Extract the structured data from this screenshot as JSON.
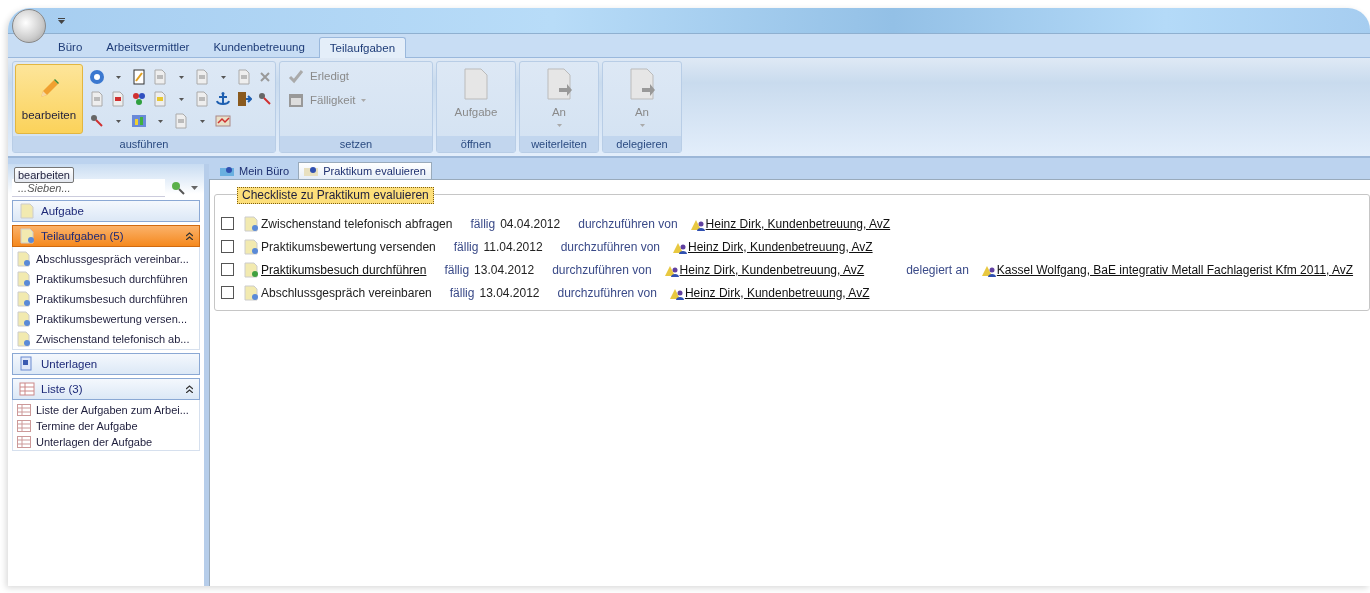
{
  "ribbon_tabs": [
    {
      "label": "Büro",
      "selected": false
    },
    {
      "label": "Arbeitsvermittler",
      "selected": false
    },
    {
      "label": "Kundenbetreuung",
      "selected": false
    },
    {
      "label": "Teilaufgaben",
      "selected": true
    }
  ],
  "ribbon": {
    "edit_button": {
      "label": "bearbeiten",
      "selected": true
    },
    "groups": [
      {
        "kind": "tools",
        "label": "ausführen"
      },
      {
        "kind": "checks",
        "label": "setzen",
        "items": [
          {
            "label": "Erledigt",
            "disabled": true,
            "has_menu": false
          },
          {
            "label": "Fälligkeit",
            "disabled": true,
            "has_menu": true
          }
        ]
      },
      {
        "kind": "large",
        "label": "öffnen",
        "button": {
          "label": "Aufgabe",
          "disabled": true,
          "has_menu": false
        }
      },
      {
        "kind": "large",
        "label": "weiterleiten",
        "button": {
          "label": "An",
          "disabled": true,
          "has_menu": true
        }
      },
      {
        "kind": "large",
        "label": "delegieren",
        "button": {
          "label": "An",
          "disabled": true,
          "has_menu": true
        }
      }
    ]
  },
  "tooltip": "bearbeiten",
  "sidebar": {
    "filter": {
      "placeholder": "...Sieben..."
    },
    "sections": [
      {
        "kind": "task",
        "label": "Aufgabe",
        "selected": false,
        "expanded": false
      },
      {
        "kind": "subtasks",
        "label": "Teilaufgaben (5)",
        "selected": true,
        "expanded": true,
        "items": [
          "Abschlussgespräch vereinbar...",
          "Praktikumsbesuch durchführen",
          "Praktikumsbesuch durchführen",
          "Praktikumsbewertung versen...",
          "Zwischenstand telefonisch ab..."
        ]
      },
      {
        "kind": "documents",
        "label": "Unterlagen",
        "selected": false,
        "expanded": false
      },
      {
        "kind": "lists",
        "label": "Liste (3)",
        "selected": false,
        "expanded": true,
        "items": [
          "Liste der Aufgaben zum Arbei...",
          "Termine der Aufgabe",
          "Unterlagen der Aufgabe"
        ]
      }
    ]
  },
  "doc_tabs": [
    {
      "label": "Mein Büro",
      "selected": false
    },
    {
      "label": "Praktikum evaluieren",
      "selected": true
    }
  ],
  "checklist": {
    "title": "Checkliste zu Praktikum evaluieren",
    "rows": [
      {
        "checked": false,
        "task": "Zwischenstand telefonisch abfragen",
        "task_link": false,
        "due_label": "fällig",
        "due": "04.04.2012",
        "assignee_label": "durchzuführen von",
        "assignee": "Heinz Dirk, Kundenbetreuung, AvZ"
      },
      {
        "checked": false,
        "task": "Praktikumsbewertung versenden",
        "task_link": false,
        "due_label": "fällig",
        "due": "11.04.2012",
        "assignee_label": "durchzuführen von",
        "assignee": "Heinz Dirk, Kundenbetreuung, AvZ"
      },
      {
        "checked": false,
        "task": "Praktikumsbesuch durchführen",
        "task_link": true,
        "due_label": "fällig",
        "due": "13.04.2012",
        "assignee_label": "durchzuführen von",
        "assignee": "Heinz Dirk, Kundenbetreuung, AvZ",
        "delegate_label": "delegiert an",
        "delegate": "Kassel Wolfgang, BaE integrativ Metall Fachlagerist Kfm 2011, AvZ"
      },
      {
        "checked": false,
        "task": "Abschlussgespräch vereinbaren",
        "task_link": false,
        "due_label": "fällig",
        "due": "13.04.2012",
        "assignee_label": "durchzuführen von",
        "assignee": "Heinz Dirk, Kundenbetreuung, AvZ"
      }
    ]
  }
}
